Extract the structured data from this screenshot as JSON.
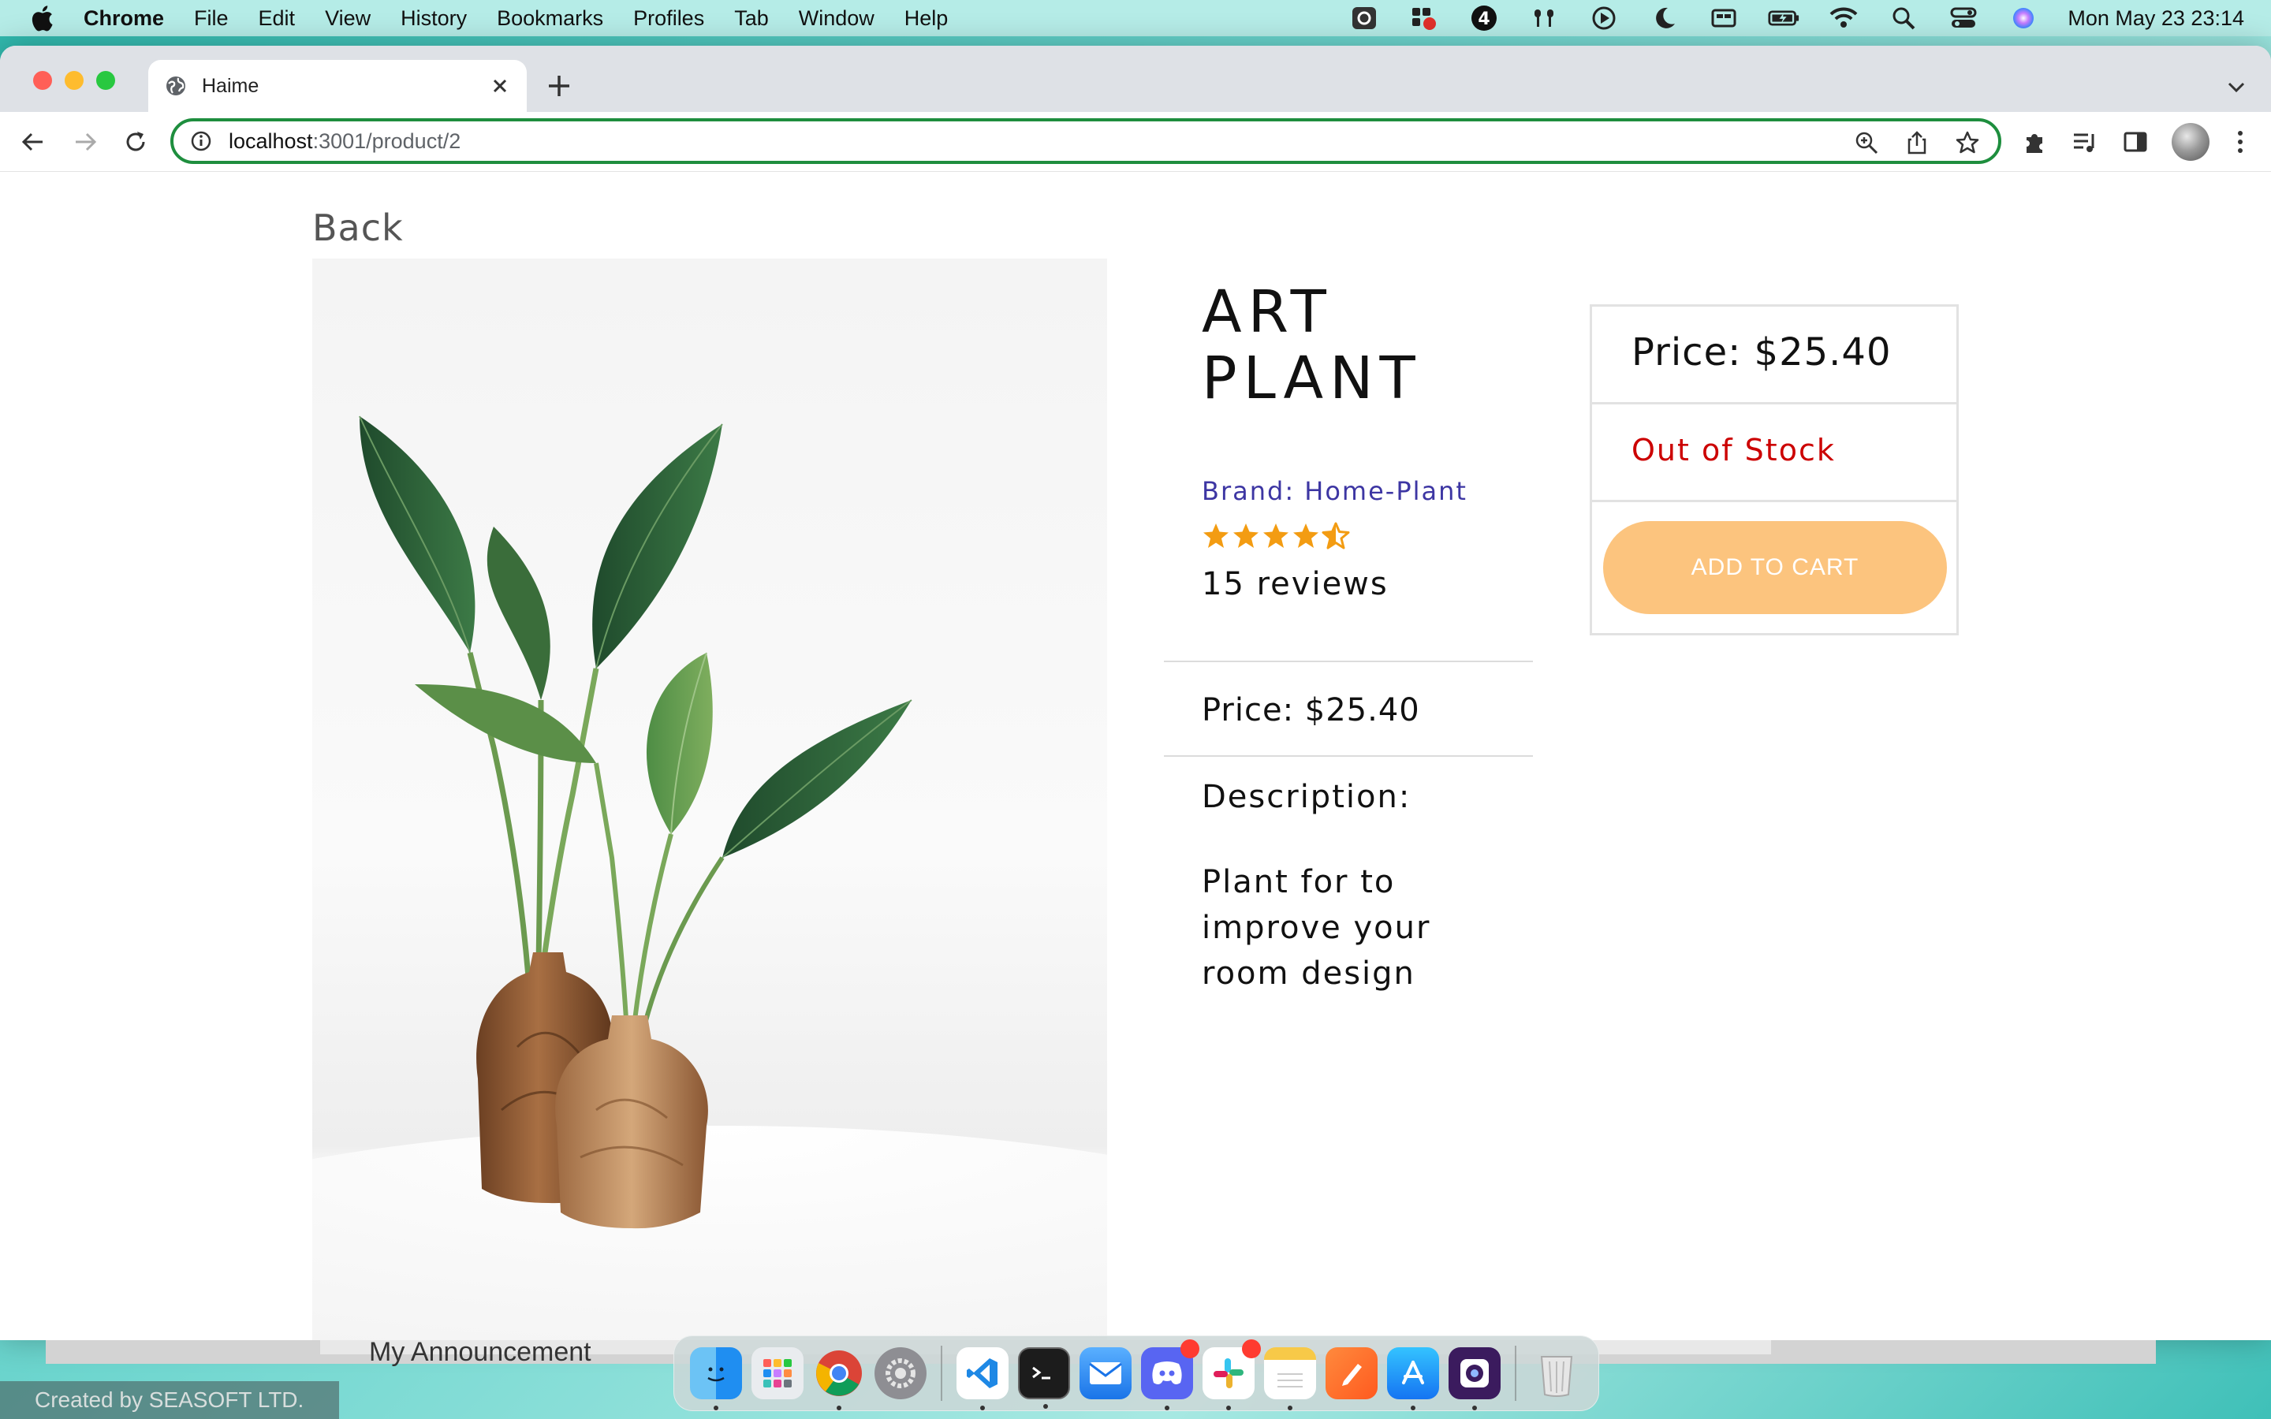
{
  "menubar": {
    "app_name": "Chrome",
    "items": [
      "File",
      "Edit",
      "View",
      "History",
      "Bookmarks",
      "Profiles",
      "Tab",
      "Window",
      "Help"
    ],
    "clock": "Mon May 23  23:14",
    "status_icons": [
      "screenshot-icon",
      "screen-record-icon",
      "app-4-icon",
      "airpods-icon",
      "play-icon",
      "moon-icon",
      "display-icon",
      "battery-icon",
      "wifi-icon",
      "spotlight-icon",
      "control-center-icon",
      "siri-icon"
    ]
  },
  "browser": {
    "tab_title": "Haime",
    "url_host": "localhost",
    "url_rest": ":3001/product/2"
  },
  "page": {
    "back_label": "Back",
    "product": {
      "title_line1": "ART",
      "title_line2": "PLANT",
      "brand": "Brand: Home-Plant",
      "rating": 4.5,
      "rating_max": 5,
      "reviews": "15 reviews",
      "price": "Price: $25.40",
      "description_label": "Description:",
      "description": "Plant for to improve your room design"
    },
    "buy_box": {
      "price": "Price: $25.40",
      "stock_status": "Out of Stock",
      "add_to_cart_label": "ADD TO CART"
    },
    "colors": {
      "brand": "#3d36a3",
      "out_of_stock": "#cc0000",
      "add_to_cart_bg": "#fcc47e",
      "star": "#f39c12",
      "omnibox_focus": "#1e8e3e"
    }
  },
  "background": {
    "behind_window_text": "My Announcement"
  },
  "dock": {
    "apps": [
      "Finder",
      "Launchpad",
      "Google Chrome",
      "System Preferences",
      "Visual Studio Code",
      "Terminal",
      "Mail",
      "Discord",
      "Slack",
      "Notes",
      "Pencil",
      "App Store",
      "Screenium",
      "Trash"
    ]
  },
  "watermark": "Created by SEASOFT LTD."
}
